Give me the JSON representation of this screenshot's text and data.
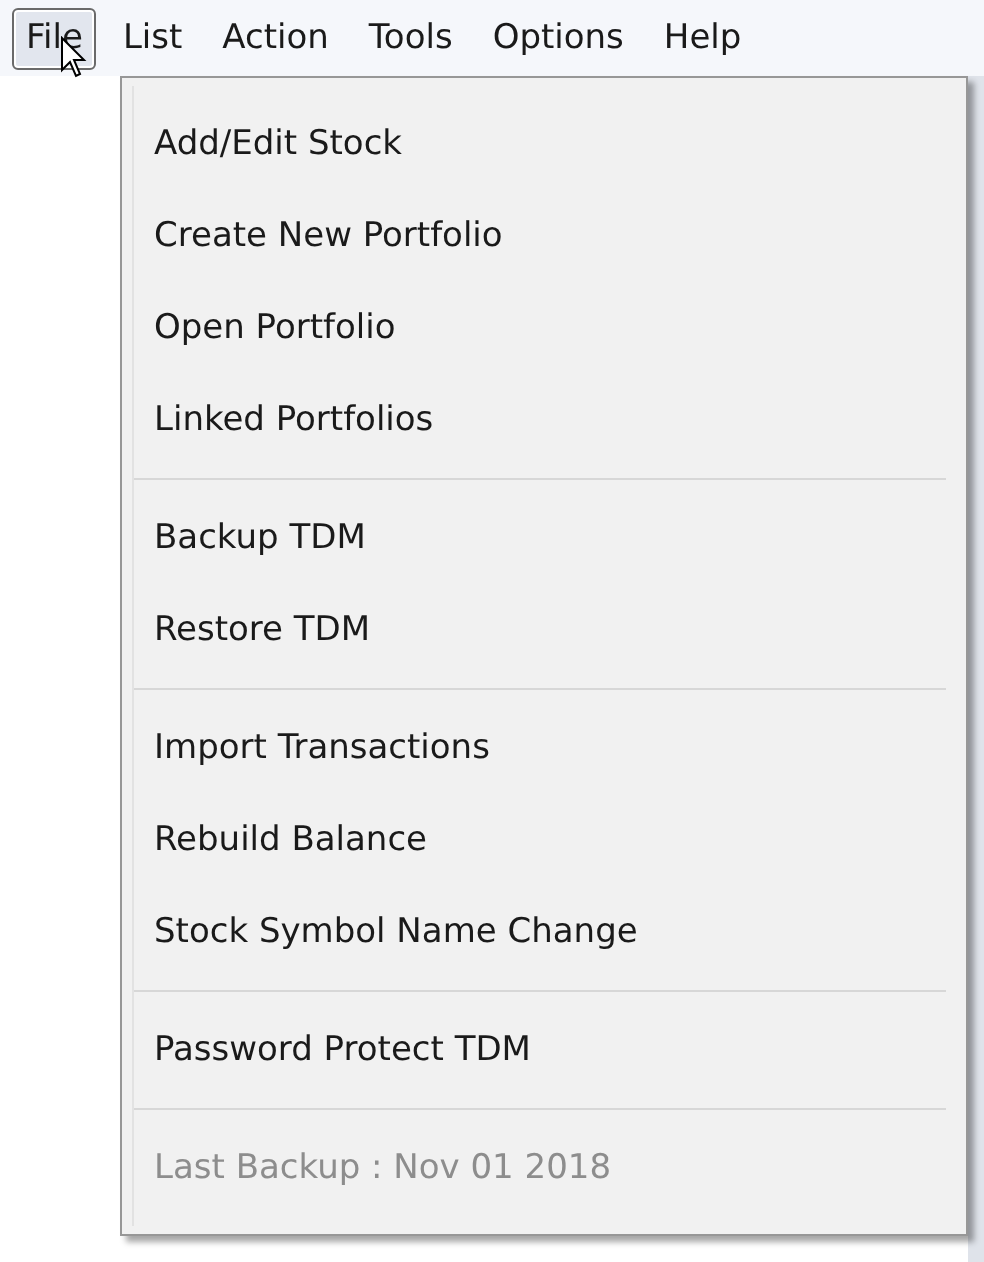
{
  "menu_bar": [
    {
      "label": "File",
      "selected": true
    },
    {
      "label": "List",
      "selected": false
    },
    {
      "label": "Action",
      "selected": false
    },
    {
      "label": "Tools",
      "selected": false
    },
    {
      "label": "Options",
      "selected": false
    },
    {
      "label": "Help",
      "selected": false
    }
  ],
  "dropdown": {
    "groups": [
      [
        {
          "label": "Add/Edit Stock",
          "disabled": false
        },
        {
          "label": "Create New Portfolio",
          "disabled": false
        },
        {
          "label": "Open Portfolio",
          "disabled": false
        },
        {
          "label": "Linked Portfolios",
          "disabled": false
        }
      ],
      [
        {
          "label": "Backup TDM",
          "disabled": false
        },
        {
          "label": "Restore TDM",
          "disabled": false
        }
      ],
      [
        {
          "label": "Import Transactions",
          "disabled": false
        },
        {
          "label": "Rebuild Balance",
          "disabled": false
        },
        {
          "label": "Stock Symbol Name Change",
          "disabled": false
        }
      ],
      [
        {
          "label": "Password Protect TDM",
          "disabled": false
        }
      ],
      [
        {
          "label": "Last Backup : Nov 01 2018",
          "disabled": true
        }
      ]
    ]
  }
}
